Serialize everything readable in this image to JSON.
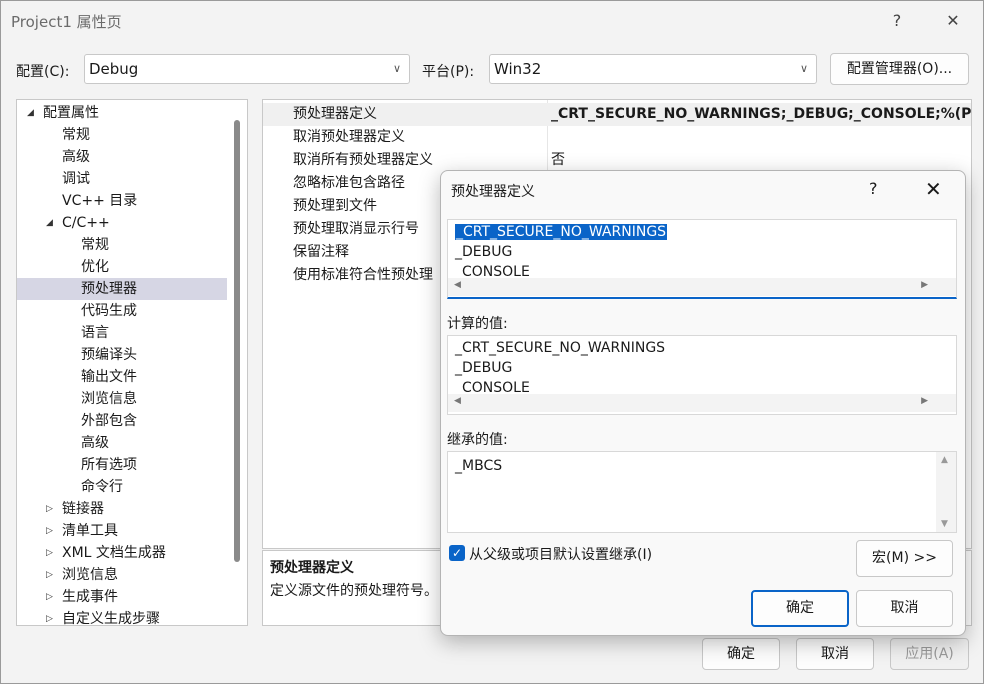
{
  "window": {
    "title": "Project1 属性页",
    "help": "?",
    "close": "✕"
  },
  "config": {
    "config_label": "配置(C):",
    "config_value": "Debug",
    "platform_label": "平台(P):",
    "platform_value": "Win32",
    "manager_button": "配置管理器(O)..."
  },
  "tree": [
    {
      "label": "配置属性",
      "arrow": "◢",
      "indent": 0,
      "selected": false
    },
    {
      "label": "常规",
      "arrow": "",
      "indent": 1,
      "selected": false
    },
    {
      "label": "高级",
      "arrow": "",
      "indent": 1,
      "selected": false
    },
    {
      "label": "调试",
      "arrow": "",
      "indent": 1,
      "selected": false
    },
    {
      "label": "VC++ 目录",
      "arrow": "",
      "indent": 1,
      "selected": false
    },
    {
      "label": "C/C++",
      "arrow": "◢",
      "indent": 1,
      "selected": false
    },
    {
      "label": "常规",
      "arrow": "",
      "indent": 2,
      "selected": false
    },
    {
      "label": "优化",
      "arrow": "",
      "indent": 2,
      "selected": false
    },
    {
      "label": "预处理器",
      "arrow": "",
      "indent": 2,
      "selected": true
    },
    {
      "label": "代码生成",
      "arrow": "",
      "indent": 2,
      "selected": false
    },
    {
      "label": "语言",
      "arrow": "",
      "indent": 2,
      "selected": false
    },
    {
      "label": "预编译头",
      "arrow": "",
      "indent": 2,
      "selected": false
    },
    {
      "label": "输出文件",
      "arrow": "",
      "indent": 2,
      "selected": false
    },
    {
      "label": "浏览信息",
      "arrow": "",
      "indent": 2,
      "selected": false
    },
    {
      "label": "外部包含",
      "arrow": "",
      "indent": 2,
      "selected": false
    },
    {
      "label": "高级",
      "arrow": "",
      "indent": 2,
      "selected": false
    },
    {
      "label": "所有选项",
      "arrow": "",
      "indent": 2,
      "selected": false
    },
    {
      "label": "命令行",
      "arrow": "",
      "indent": 2,
      "selected": false
    },
    {
      "label": "链接器",
      "arrow": "▷",
      "indent": 1,
      "selected": false
    },
    {
      "label": "清单工具",
      "arrow": "▷",
      "indent": 1,
      "selected": false
    },
    {
      "label": "XML 文档生成器",
      "arrow": "▷",
      "indent": 1,
      "selected": false
    },
    {
      "label": "浏览信息",
      "arrow": "▷",
      "indent": 1,
      "selected": false
    },
    {
      "label": "生成事件",
      "arrow": "▷",
      "indent": 1,
      "selected": false
    },
    {
      "label": "自定义生成步骤",
      "arrow": "▷",
      "indent": 1,
      "selected": false
    }
  ],
  "grid": [
    {
      "name": "预处理器定义",
      "value": "_CRT_SECURE_NO_WARNINGS;_DEBUG;_CONSOLE;%(Pr"
    },
    {
      "name": "取消预处理器定义",
      "value": ""
    },
    {
      "name": "取消所有预处理器定义",
      "value": "否"
    },
    {
      "name": "忽略标准包含路径",
      "value": ""
    },
    {
      "name": "预处理到文件",
      "value": ""
    },
    {
      "name": "预处理取消显示行号",
      "value": ""
    },
    {
      "name": "保留注释",
      "value": ""
    },
    {
      "name": "使用标准符合性预处理",
      "value": ""
    }
  ],
  "description": {
    "title": "预处理器定义",
    "text": "定义源文件的预处理符号。"
  },
  "footer": {
    "ok": "确定",
    "cancel": "取消",
    "apply": "应用(A)"
  },
  "dialog": {
    "title": "预处理器定义",
    "help": "?",
    "close": "✕",
    "edit_lines": [
      "_CRT_SECURE_NO_WARNINGS",
      "_DEBUG",
      "_CONSOLE"
    ],
    "computed_label": "计算的值:",
    "computed_lines": [
      "_CRT_SECURE_NO_WARNINGS",
      "_DEBUG",
      "_CONSOLE"
    ],
    "inherited_label": "继承的值:",
    "inherited_lines": [
      "_MBCS"
    ],
    "inherit_checkbox": "从父级或项目默认设置继承(I)",
    "inherit_checked": true,
    "macro_button": "宏(M) >>",
    "ok": "确定",
    "cancel": "取消"
  }
}
